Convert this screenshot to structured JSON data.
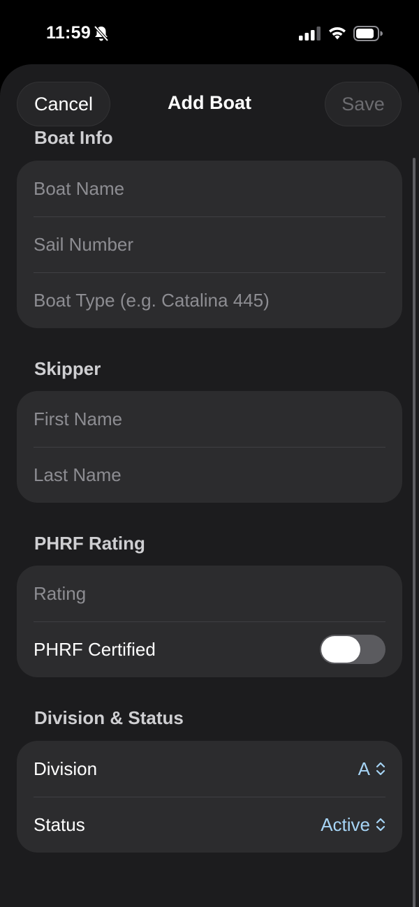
{
  "status_bar": {
    "time": "11:59",
    "icons": [
      "bell-slash-icon",
      "cellular-signal-icon",
      "wifi-icon",
      "battery-icon"
    ]
  },
  "nav": {
    "cancel_label": "Cancel",
    "title": "Add Boat",
    "save_label": "Save"
  },
  "sections": {
    "boat_info": {
      "header": "Boat Info",
      "boat_name_placeholder": "Boat Name",
      "sail_number_placeholder": "Sail Number",
      "boat_type_placeholder": "Boat Type (e.g. Catalina 445)"
    },
    "skipper": {
      "header": "Skipper",
      "first_name_placeholder": "First Name",
      "last_name_placeholder": "Last Name"
    },
    "phrf": {
      "header": "PHRF Rating",
      "rating_placeholder": "Rating",
      "certified_label": "PHRF Certified",
      "certified_on": false
    },
    "division_status": {
      "header": "Division & Status",
      "division_label": "Division",
      "division_value": "A",
      "status_label": "Status",
      "status_value": "Active"
    }
  },
  "colors": {
    "accent": "#a6d4f5",
    "sheet_background": "#1c1c1e",
    "group_background": "#2c2c2e"
  }
}
